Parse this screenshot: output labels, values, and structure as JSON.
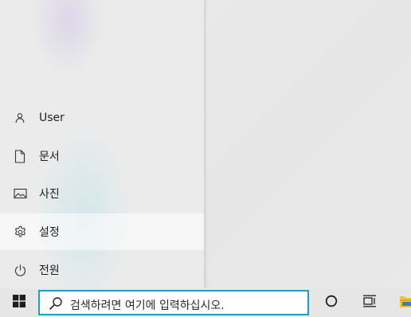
{
  "start_menu": {
    "items": [
      {
        "id": "user",
        "label": "User",
        "icon": "user-icon"
      },
      {
        "id": "documents",
        "label": "문서",
        "icon": "document-icon"
      },
      {
        "id": "pictures",
        "label": "사진",
        "icon": "pictures-icon"
      },
      {
        "id": "settings",
        "label": "설정",
        "icon": "gear-icon",
        "hovered": true
      },
      {
        "id": "power",
        "label": "전원",
        "icon": "power-icon"
      }
    ]
  },
  "taskbar": {
    "start_icon": "windows-logo-icon",
    "search": {
      "placeholder": "검색하려면 여기에 입력하십시오.",
      "icon": "search-icon"
    },
    "buttons": [
      {
        "id": "cortana",
        "icon": "cortana-circle-icon"
      },
      {
        "id": "task-view",
        "icon": "task-view-icon"
      },
      {
        "id": "file-explorer",
        "icon": "folder-icon"
      }
    ]
  },
  "colors": {
    "search_border": "#1aa0c9",
    "folder_yellow": "#f2c230"
  }
}
